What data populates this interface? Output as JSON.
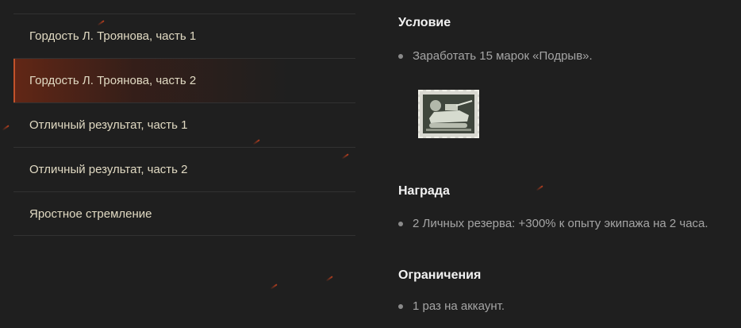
{
  "menu": {
    "items": [
      {
        "label": "Гордость Л. Троянова, часть 1",
        "active": false
      },
      {
        "label": "Гордость Л. Троянова, часть 2",
        "active": true
      },
      {
        "label": "Отличный результат, часть 1",
        "active": false
      },
      {
        "label": "Отличный результат, часть 2",
        "active": false
      },
      {
        "label": "Яростное стремление",
        "active": false
      }
    ]
  },
  "details": {
    "condition_title": "Условие",
    "condition_text": "Заработать 15 марок «Подрыв».",
    "stamp_icon": "tank-stamp-icon",
    "reward_title": "Награда",
    "reward_text": "2 Личных резерва: +300% к опыту экипажа на 2 часа.",
    "limits_title": "Ограничения",
    "limits_text": "1 раз на аккаунт."
  },
  "colors": {
    "background": "#1f1f1f",
    "menu_text": "#e0d9c2",
    "active_accent": "#c2522a",
    "heading": "#f2f2f2",
    "body_text": "#a5a5a5"
  }
}
